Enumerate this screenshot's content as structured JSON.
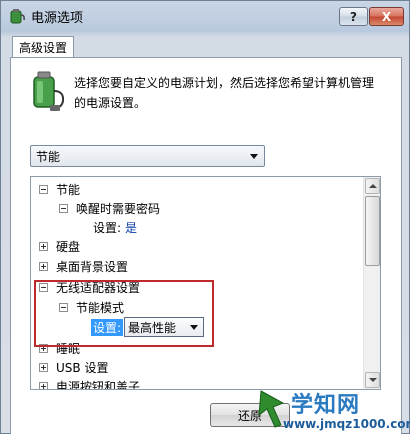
{
  "window": {
    "title": "电源选项",
    "help_label": "?",
    "close_label": "X"
  },
  "tab": {
    "label": "高级设置"
  },
  "description": "选择您要自定义的电源计划，然后选择您希望计算机管理的电源设置。",
  "plan_select": {
    "value": "节能"
  },
  "tree": {
    "rows": [
      {
        "label": "节能",
        "expander": "minus"
      },
      {
        "label": "唤醒时需要密码",
        "expander": "minus"
      },
      {
        "label": "设置:",
        "value": "是"
      },
      {
        "label": "硬盘",
        "expander": "plus"
      },
      {
        "label": "桌面背景设置",
        "expander": "plus"
      },
      {
        "label": "无线适配器设置",
        "expander": "minus"
      },
      {
        "label": "节能模式",
        "expander": "minus"
      },
      {
        "label": "设置:",
        "value": "最高性能"
      },
      {
        "label": "睡眠",
        "expander": "plus"
      },
      {
        "label": "USB 设置",
        "expander": "plus"
      },
      {
        "label": "电源按钮和盖子",
        "expander": "plus"
      }
    ]
  },
  "buttons": {
    "restore_label": "还原"
  },
  "watermark": {
    "title": "学知网",
    "url": "www.jmqz1000.com"
  },
  "colors": {
    "highlight_border": "#c0292b",
    "selection": "#3399ff",
    "value_text": "#0a3ea8"
  }
}
